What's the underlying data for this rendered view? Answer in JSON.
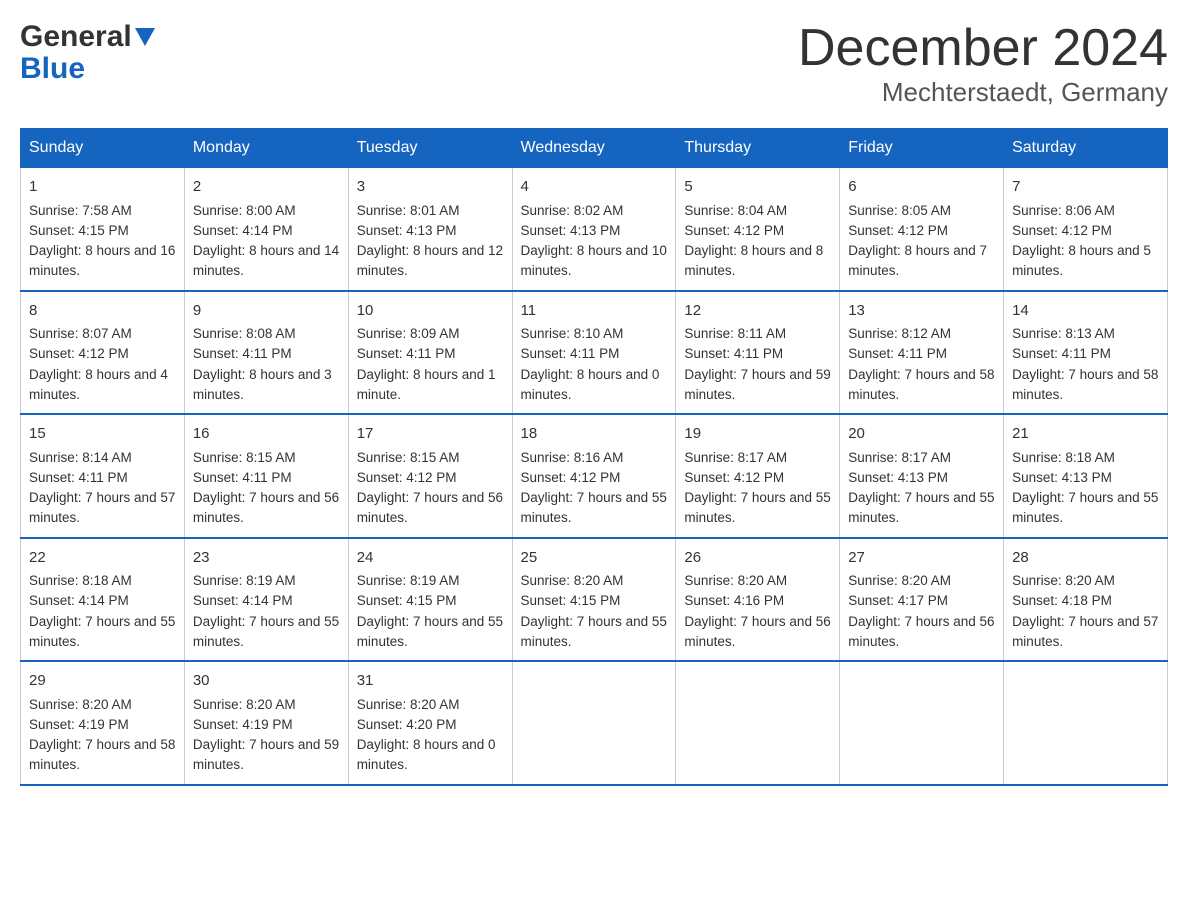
{
  "header": {
    "logo_line1": "General",
    "logo_line2": "Blue",
    "title": "December 2024",
    "subtitle": "Mechterstaedt, Germany"
  },
  "days_of_week": [
    "Sunday",
    "Monday",
    "Tuesday",
    "Wednesday",
    "Thursday",
    "Friday",
    "Saturday"
  ],
  "weeks": [
    [
      {
        "day": "1",
        "sunrise": "Sunrise: 7:58 AM",
        "sunset": "Sunset: 4:15 PM",
        "daylight": "Daylight: 8 hours and 16 minutes."
      },
      {
        "day": "2",
        "sunrise": "Sunrise: 8:00 AM",
        "sunset": "Sunset: 4:14 PM",
        "daylight": "Daylight: 8 hours and 14 minutes."
      },
      {
        "day": "3",
        "sunrise": "Sunrise: 8:01 AM",
        "sunset": "Sunset: 4:13 PM",
        "daylight": "Daylight: 8 hours and 12 minutes."
      },
      {
        "day": "4",
        "sunrise": "Sunrise: 8:02 AM",
        "sunset": "Sunset: 4:13 PM",
        "daylight": "Daylight: 8 hours and 10 minutes."
      },
      {
        "day": "5",
        "sunrise": "Sunrise: 8:04 AM",
        "sunset": "Sunset: 4:12 PM",
        "daylight": "Daylight: 8 hours and 8 minutes."
      },
      {
        "day": "6",
        "sunrise": "Sunrise: 8:05 AM",
        "sunset": "Sunset: 4:12 PM",
        "daylight": "Daylight: 8 hours and 7 minutes."
      },
      {
        "day": "7",
        "sunrise": "Sunrise: 8:06 AM",
        "sunset": "Sunset: 4:12 PM",
        "daylight": "Daylight: 8 hours and 5 minutes."
      }
    ],
    [
      {
        "day": "8",
        "sunrise": "Sunrise: 8:07 AM",
        "sunset": "Sunset: 4:12 PM",
        "daylight": "Daylight: 8 hours and 4 minutes."
      },
      {
        "day": "9",
        "sunrise": "Sunrise: 8:08 AM",
        "sunset": "Sunset: 4:11 PM",
        "daylight": "Daylight: 8 hours and 3 minutes."
      },
      {
        "day": "10",
        "sunrise": "Sunrise: 8:09 AM",
        "sunset": "Sunset: 4:11 PM",
        "daylight": "Daylight: 8 hours and 1 minute."
      },
      {
        "day": "11",
        "sunrise": "Sunrise: 8:10 AM",
        "sunset": "Sunset: 4:11 PM",
        "daylight": "Daylight: 8 hours and 0 minutes."
      },
      {
        "day": "12",
        "sunrise": "Sunrise: 8:11 AM",
        "sunset": "Sunset: 4:11 PM",
        "daylight": "Daylight: 7 hours and 59 minutes."
      },
      {
        "day": "13",
        "sunrise": "Sunrise: 8:12 AM",
        "sunset": "Sunset: 4:11 PM",
        "daylight": "Daylight: 7 hours and 58 minutes."
      },
      {
        "day": "14",
        "sunrise": "Sunrise: 8:13 AM",
        "sunset": "Sunset: 4:11 PM",
        "daylight": "Daylight: 7 hours and 58 minutes."
      }
    ],
    [
      {
        "day": "15",
        "sunrise": "Sunrise: 8:14 AM",
        "sunset": "Sunset: 4:11 PM",
        "daylight": "Daylight: 7 hours and 57 minutes."
      },
      {
        "day": "16",
        "sunrise": "Sunrise: 8:15 AM",
        "sunset": "Sunset: 4:11 PM",
        "daylight": "Daylight: 7 hours and 56 minutes."
      },
      {
        "day": "17",
        "sunrise": "Sunrise: 8:15 AM",
        "sunset": "Sunset: 4:12 PM",
        "daylight": "Daylight: 7 hours and 56 minutes."
      },
      {
        "day": "18",
        "sunrise": "Sunrise: 8:16 AM",
        "sunset": "Sunset: 4:12 PM",
        "daylight": "Daylight: 7 hours and 55 minutes."
      },
      {
        "day": "19",
        "sunrise": "Sunrise: 8:17 AM",
        "sunset": "Sunset: 4:12 PM",
        "daylight": "Daylight: 7 hours and 55 minutes."
      },
      {
        "day": "20",
        "sunrise": "Sunrise: 8:17 AM",
        "sunset": "Sunset: 4:13 PM",
        "daylight": "Daylight: 7 hours and 55 minutes."
      },
      {
        "day": "21",
        "sunrise": "Sunrise: 8:18 AM",
        "sunset": "Sunset: 4:13 PM",
        "daylight": "Daylight: 7 hours and 55 minutes."
      }
    ],
    [
      {
        "day": "22",
        "sunrise": "Sunrise: 8:18 AM",
        "sunset": "Sunset: 4:14 PM",
        "daylight": "Daylight: 7 hours and 55 minutes."
      },
      {
        "day": "23",
        "sunrise": "Sunrise: 8:19 AM",
        "sunset": "Sunset: 4:14 PM",
        "daylight": "Daylight: 7 hours and 55 minutes."
      },
      {
        "day": "24",
        "sunrise": "Sunrise: 8:19 AM",
        "sunset": "Sunset: 4:15 PM",
        "daylight": "Daylight: 7 hours and 55 minutes."
      },
      {
        "day": "25",
        "sunrise": "Sunrise: 8:20 AM",
        "sunset": "Sunset: 4:15 PM",
        "daylight": "Daylight: 7 hours and 55 minutes."
      },
      {
        "day": "26",
        "sunrise": "Sunrise: 8:20 AM",
        "sunset": "Sunset: 4:16 PM",
        "daylight": "Daylight: 7 hours and 56 minutes."
      },
      {
        "day": "27",
        "sunrise": "Sunrise: 8:20 AM",
        "sunset": "Sunset: 4:17 PM",
        "daylight": "Daylight: 7 hours and 56 minutes."
      },
      {
        "day": "28",
        "sunrise": "Sunrise: 8:20 AM",
        "sunset": "Sunset: 4:18 PM",
        "daylight": "Daylight: 7 hours and 57 minutes."
      }
    ],
    [
      {
        "day": "29",
        "sunrise": "Sunrise: 8:20 AM",
        "sunset": "Sunset: 4:19 PM",
        "daylight": "Daylight: 7 hours and 58 minutes."
      },
      {
        "day": "30",
        "sunrise": "Sunrise: 8:20 AM",
        "sunset": "Sunset: 4:19 PM",
        "daylight": "Daylight: 7 hours and 59 minutes."
      },
      {
        "day": "31",
        "sunrise": "Sunrise: 8:20 AM",
        "sunset": "Sunset: 4:20 PM",
        "daylight": "Daylight: 8 hours and 0 minutes."
      },
      null,
      null,
      null,
      null
    ]
  ]
}
